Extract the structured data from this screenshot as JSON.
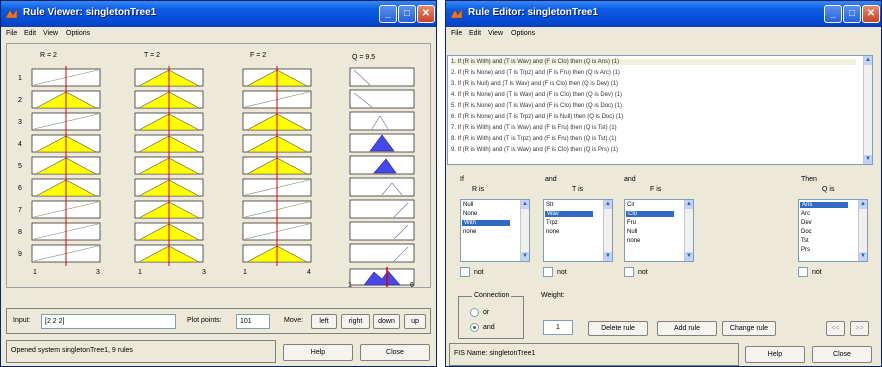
{
  "viewer": {
    "title": "Rule Viewer: singletonTree1",
    "menu": [
      "File",
      "Edit",
      "View",
      "Options"
    ],
    "inputs": [
      {
        "header": "R = 2",
        "axis_min": "1",
        "axis_max": "3"
      },
      {
        "header": "T = 2",
        "axis_min": "1",
        "axis_max": "3"
      },
      {
        "header": "F = 2",
        "axis_min": "1",
        "axis_max": "4"
      }
    ],
    "output": {
      "header": "Q = 9.5",
      "axis_min": "1",
      "axis_max": "6"
    },
    "row_numbers": [
      "1",
      "2",
      "3",
      "4",
      "5",
      "6",
      "7",
      "8",
      "9"
    ],
    "input_label": "Input:",
    "input_value": "[2 2 2]",
    "plot_points_label": "Plot points:",
    "plot_points_value": "101",
    "move_label": "Move:",
    "move_buttons": [
      "left",
      "right",
      "down",
      "up"
    ],
    "status": "Opened system singletonTree1, 9 rules",
    "help": "Help",
    "close": "Close"
  },
  "editor": {
    "title": "Rule Editor: singletonTree1",
    "menu": [
      "File",
      "Edit",
      "View",
      "Options"
    ],
    "rules": [
      "1. If (R is With) and (T is Wav) and (F is Clo) then (Q is Ans) (1)",
      "2. If (R is None) and (T is Trpz) and (F is Fru) then (Q is Arc) (1)",
      "3. If (R is Null) and (T is Wav) and (F is Clo) then (Q is Dev) (1)",
      "4. If (R is None) and (T is Wav) and (F is Clo) then (Q is Dev) (1)",
      "5. If (R is None) and (T is Wav) and (F is Clo) then (Q is Doc) (1)",
      "6. If (R is None) and (T is Trpz) and (F is Null) then (Q is Doc) (1)",
      "7. If (R is With) and (T is Wav) and (F is Fru) then (Q is Tst) (1)",
      "8. If (R is With) and (T is Trpz) and (F is Fru) then (Q is Tst) (1)",
      "9. If (R is With) and (T is Wav) and (F is Clo) then (Q is Prs) (1)"
    ],
    "if_label": "If",
    "and1_label": "and",
    "and2_label": "and",
    "then_label": "Then",
    "r_is": "R is",
    "t_is": "T is",
    "f_is": "F is",
    "q_is": "Q is",
    "r_options": [
      "Null",
      "None",
      "With",
      "none"
    ],
    "t_options": [
      "Str",
      "Wav",
      "Trpz",
      "none"
    ],
    "f_options": [
      "Cir",
      "Clo",
      "Fru",
      "Null",
      "none"
    ],
    "q_options": [
      "Ans",
      "Arc",
      "Dev",
      "Doc",
      "Tst",
      "Prs"
    ],
    "not_label": "not",
    "connection_label": "Connection",
    "or_label": "or",
    "and_label": "and",
    "weight_label": "Weight:",
    "weight_value": "1",
    "delete_rule": "Delete rule",
    "add_rule": "Add rule",
    "change_rule": "Change rule",
    "prev_btn": "<<",
    "next_btn": ">>",
    "status": "FIS Name: singletonTree1",
    "help": "Help",
    "close": "Close"
  },
  "colors": {
    "title_blue": "#0a5fe4",
    "fill_yellow": "#ffff00",
    "fill_blue": "#4848e8",
    "selection_blue": "#316ac5",
    "red_line": "#e00000"
  }
}
